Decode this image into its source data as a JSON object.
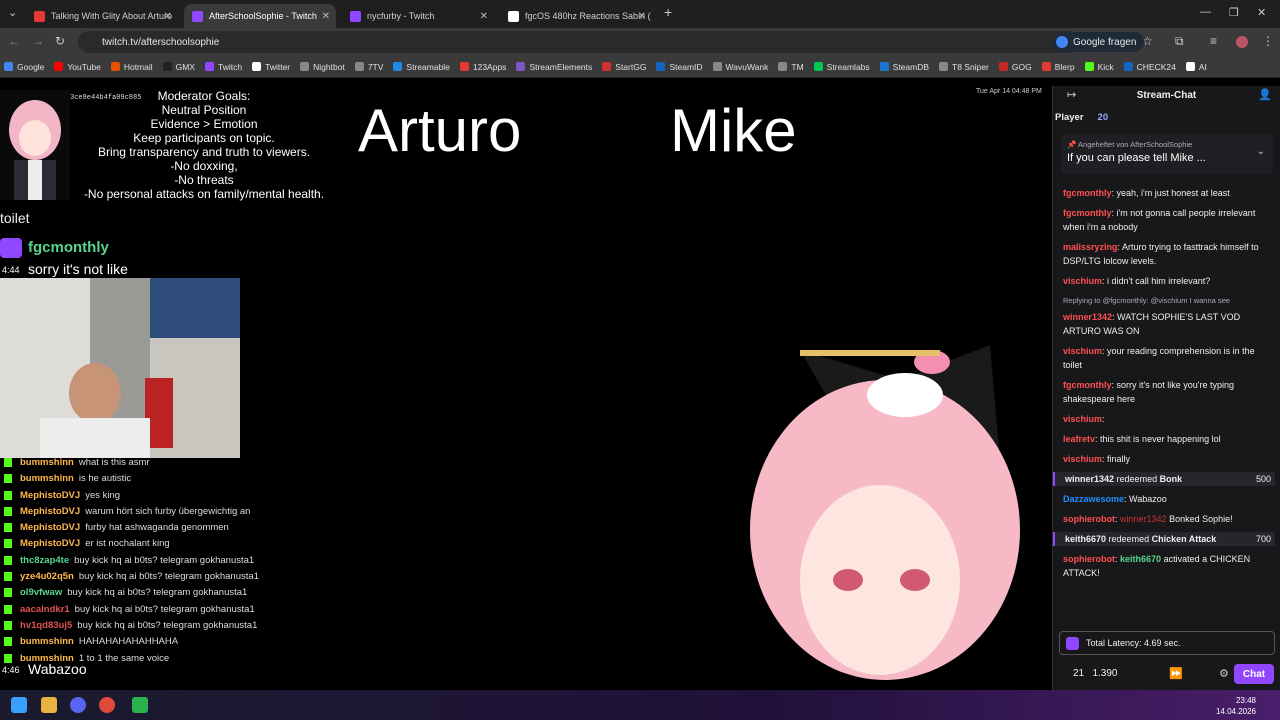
{
  "browser": {
    "tabs": [
      {
        "title": "Talking With Glity About Arturo",
        "color": "#e53935"
      },
      {
        "title": "AfterSchoolSophie - Twitch",
        "color": "#9147ff"
      },
      {
        "title": "nycfurby - Twitch",
        "color": "#9147ff"
      },
      {
        "title": "fgcOS 480hz Reactions Sabin (",
        "color": "#ffffff"
      }
    ],
    "url": "twitch.tv/afterschoolsophie",
    "translate_label": "Google fragen",
    "bookmarks": [
      "Google",
      "YouTube",
      "Hotmail",
      "GMX",
      "Twitch",
      "Twitter",
      "Nightbot",
      "7TV",
      "Streamable",
      "123Apps",
      "StreamElements",
      "StartGG",
      "SteamID",
      "WavuWank",
      "TM",
      "Streamlabs",
      "SteamDB",
      "T8 Sniper",
      "GOG",
      "Blerp",
      "Kick",
      "CHECK24",
      "AI"
    ]
  },
  "video": {
    "hash": "3ce8e44b4fa09c885",
    "mod_goals": [
      "Moderator Goals:",
      "Neutral Position",
      "Evidence > Emotion",
      "Keep participants on topic.",
      "Bring transparency and truth to viewers.",
      "-No doxxing,",
      "-No threats",
      "-No personal attacks on family/mental health."
    ],
    "name_left": "Arturo",
    "name_right": "Mike",
    "timestamp": "Tue Apr 14 04:48 PM",
    "overlay_user": "fgcmonthly",
    "overlay_time": "4:44",
    "overlay_msg": "sorry it's not like",
    "overlay_top": "toilet",
    "overlay_bottom_time": "4:46",
    "overlay_bottom_msg": "Wabazoo",
    "kick_chat": [
      {
        "user": "bummshinn",
        "color": "#ffb84d",
        "msg": "what is this asmr"
      },
      {
        "user": "bummshinn",
        "color": "#ffb84d",
        "msg": "is he autistic"
      },
      {
        "user": "MephistoDVJ",
        "color": "#ffb84d",
        "msg": "yes king"
      },
      {
        "user": "MephistoDVJ",
        "color": "#ffb84d",
        "msg": "warum hört sich furby übergewichtig an"
      },
      {
        "user": "MephistoDVJ",
        "color": "#ffb84d",
        "msg": "furby hat ashwaganda genommen"
      },
      {
        "user": "MephistoDVJ",
        "color": "#ffb84d",
        "msg": "er ist nochalant king"
      },
      {
        "user": "thc8zap4te",
        "color": "#58d68d",
        "msg": "buy kick hq ai b0ts? telegram gokhanusta1"
      },
      {
        "user": "yze4u02q5n",
        "color": "#ffb84d",
        "msg": "buy kick hq ai b0ts? telegram gokhanusta1"
      },
      {
        "user": "ol9vfwaw",
        "color": "#58d68d",
        "msg": "buy kick hq ai b0ts? telegram gokhanusta1"
      },
      {
        "user": "aacalndkr1",
        "color": "#e05050",
        "msg": "buy kick hq ai b0ts? telegram gokhanusta1"
      },
      {
        "user": "hv1qd83uj5",
        "color": "#e05050",
        "msg": "buy kick hq ai b0ts? telegram gokhanusta1"
      },
      {
        "user": "bummshinn",
        "color": "#ffb84d",
        "msg": "HAHAHAHAHAHHAHA"
      },
      {
        "user": "bummshinn",
        "color": "#ffb84d",
        "msg": "1 to 1 the same voice"
      }
    ]
  },
  "chat": {
    "title": "Stream-Chat",
    "player_label": "Player",
    "player_count": "20",
    "pinned_by": "Angeheftet von",
    "pinned_user": "AfterSchoolSophie",
    "pinned_text": "If you can please tell Mike ...",
    "messages": [
      {
        "user": "fgcmonthly",
        "color": "#ff4f4f",
        "text": "yeah, i'm just honest at least"
      },
      {
        "user": "fgcmonthly",
        "color": "#ff4f4f",
        "text": "i'm not gonna call people irrelevant when i'm a nobody"
      },
      {
        "user": "malissryzing",
        "color": "#ff4f4f",
        "text": "Arturo trying to fasttrack himself to DSP/LTG lolcow levels."
      },
      {
        "user": "vischium",
        "color": "#ff4f4f",
        "text": "i didn't call him irrelevant?"
      },
      {
        "reply": "Replying to @fgcmonthly: @vischium I wanna see"
      },
      {
        "user": "winner1342",
        "color": "#ff4f4f",
        "text": "WATCH SOPHIE'S LAST VOD ARTURO WAS ON"
      },
      {
        "user": "vischium",
        "color": "#ff4f4f",
        "text": "your reading comprehension is in the toilet"
      },
      {
        "user": "fgcmonthly",
        "color": "#ff4f4f",
        "text": "sorry it's not like you're typing shakespeare here"
      },
      {
        "user": "vischium",
        "color": "#ff4f4f",
        "text": ""
      },
      {
        "user": "leafretv",
        "color": "#ff4f4f",
        "text": "this shit is never happening lol"
      },
      {
        "user": "vischium",
        "color": "#ff4f4f",
        "text": "finally"
      }
    ],
    "redeem1_user": "winner1342",
    "redeem1_word": "redeemed",
    "redeem1_item": "Bonk",
    "redeem1_cost": "500",
    "msg_daz_user": "Dazzawesome",
    "msg_daz_text": "Wabazoo",
    "bot_user": "sophierobot",
    "bonk_target": "winner1342",
    "bonk_text": "Bonked Sophie!",
    "redeem2_user": "keith6670",
    "redeem2_item": "Chicken Attack",
    "redeem2_cost": "700",
    "chicken_target": "keith6670",
    "chicken_text": "activated a CHICKEN ATTACK!",
    "latency": "Total Latency: 4.69 sec.",
    "bits": "21",
    "points": "1.390",
    "chat_button": "Chat"
  },
  "taskbar": {
    "time": "23:48",
    "date": "14.04.2026"
  }
}
